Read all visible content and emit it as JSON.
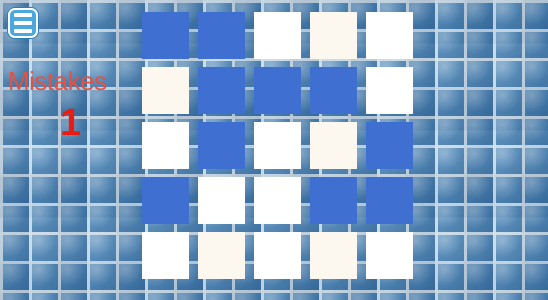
{
  "menu": {
    "icon": "menu-icon"
  },
  "status": {
    "mistakes_label": "Mistakes",
    "mistakes_count": "1"
  },
  "colors": {
    "blue": "#3e6fd1",
    "white": "#ffffff",
    "cream": "#fdf8ef",
    "mistakes_label": "#e8503f",
    "mistakes_count": "#ee1c10"
  },
  "board": {
    "rows": 5,
    "cols": 5,
    "cells": [
      [
        "blue",
        "blue",
        "white",
        "cream",
        "white"
      ],
      [
        "cream",
        "blue",
        "blue",
        "blue",
        "white"
      ],
      [
        "white",
        "blue",
        "white",
        "cream",
        "blue"
      ],
      [
        "blue",
        "white",
        "white",
        "blue",
        "blue"
      ],
      [
        "white",
        "cream",
        "white",
        "cream",
        "white"
      ]
    ]
  }
}
